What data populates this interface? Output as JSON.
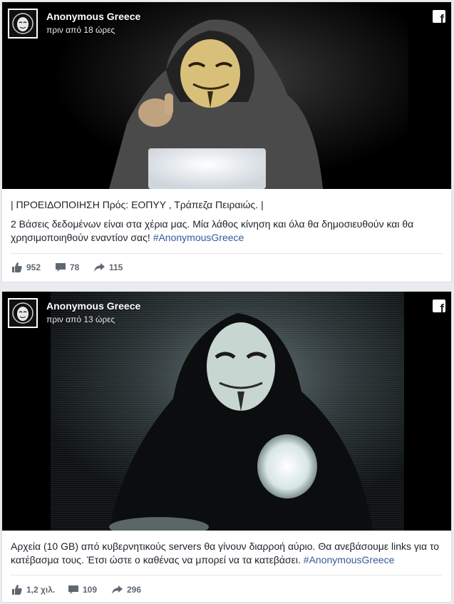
{
  "colors": {
    "page_bg": "#e9ebee",
    "link": "#365899",
    "text": "#1d2129",
    "meta": "#606770"
  },
  "icons": {
    "like": "thumbs-up-icon",
    "comment": "comment-icon",
    "share": "share-arrow-icon",
    "platform": "facebook-icon"
  },
  "posts": [
    {
      "author": "Anonymous Greece",
      "time": "πριν από 18 ώρες",
      "paragraph1": "| ΠΡΟΕΙΔΟΠΟΙΗΣΗ Πρός: ΕΟΠΥΥ , Τράπεζα Πειραιώς. |",
      "paragraph2": "2 Βάσεις δεδομένων είναι στα χέρια μας. Μία λάθος κίνηση και όλα θα δημοσιευθούν και θα χρησιμοποιηθούν εναντίον σας!",
      "hashtag": "#AnonymousGreece",
      "likes": "952",
      "comments": "78",
      "shares": "115"
    },
    {
      "author": "Anonymous Greece",
      "time": "πριν από 13 ώρες",
      "paragraph1": "Αρχεία (10 GB) από κυβερνητικούς servers θα γίνουν διαρροή αύριο. Θα ανεβάσουμε links για το κατέβασμα τους. Έτσι ώστε ο καθένας να μπορεί να τα κατεβάσει.",
      "hashtag": "#AnonymousGreece",
      "likes": "1,2 χιλ.",
      "comments": "109",
      "shares": "296"
    }
  ]
}
